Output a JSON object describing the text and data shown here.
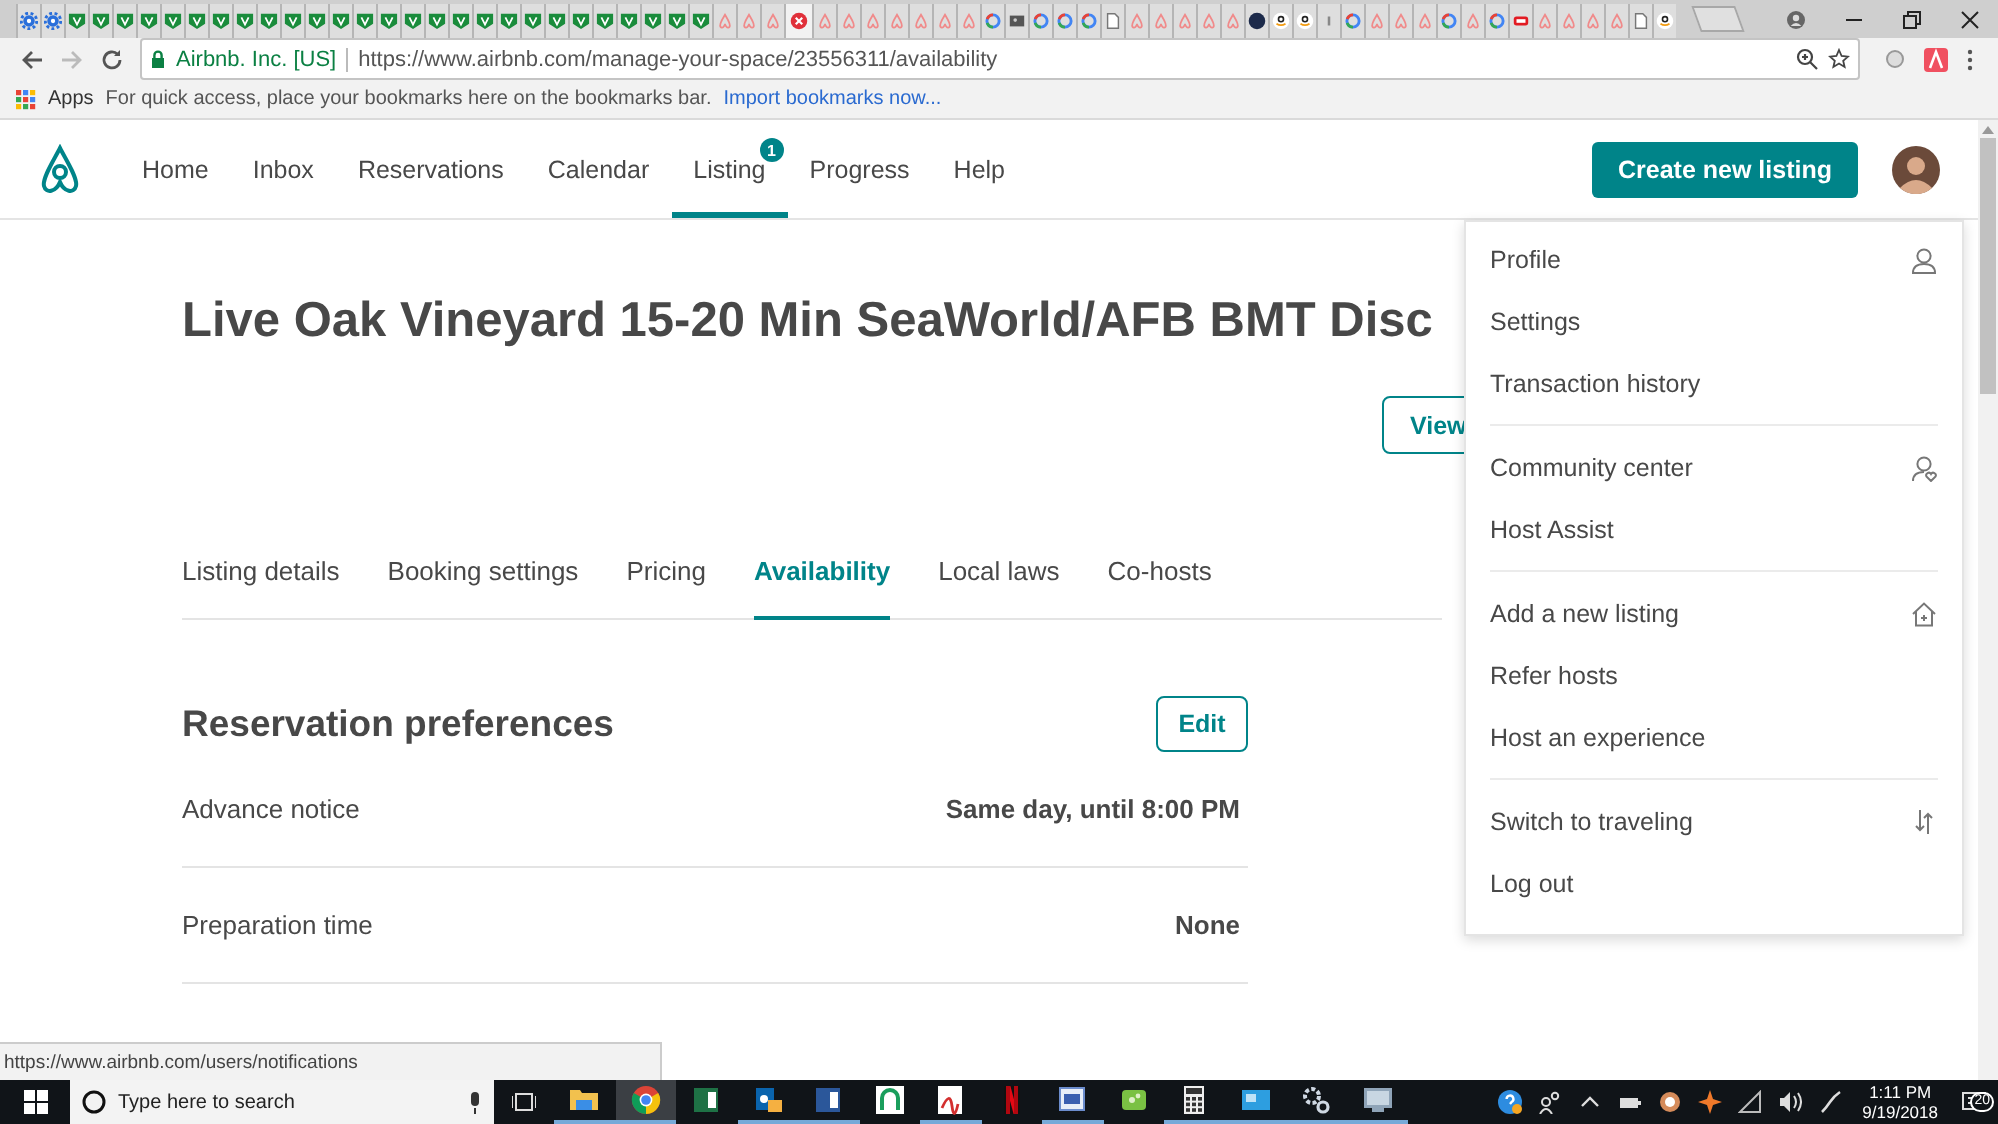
{
  "browser": {
    "tabs": [
      {
        "kind": "gear",
        "selected": false
      },
      {
        "kind": "gear",
        "selected": false
      },
      {
        "kind": "v",
        "selected": false
      },
      {
        "kind": "v",
        "selected": false
      },
      {
        "kind": "v",
        "selected": false
      },
      {
        "kind": "v",
        "selected": false
      },
      {
        "kind": "v",
        "selected": false
      },
      {
        "kind": "v",
        "selected": false
      },
      {
        "kind": "v",
        "selected": false
      },
      {
        "kind": "v",
        "selected": false
      },
      {
        "kind": "v",
        "selected": false
      },
      {
        "kind": "v",
        "selected": false
      },
      {
        "kind": "v",
        "selected": false
      },
      {
        "kind": "v",
        "selected": false
      },
      {
        "kind": "v",
        "selected": false
      },
      {
        "kind": "v",
        "selected": false
      },
      {
        "kind": "v",
        "selected": false
      },
      {
        "kind": "v",
        "selected": false
      },
      {
        "kind": "v",
        "selected": false
      },
      {
        "kind": "v",
        "selected": false
      },
      {
        "kind": "v",
        "selected": false
      },
      {
        "kind": "v",
        "selected": false
      },
      {
        "kind": "v",
        "selected": false
      },
      {
        "kind": "v",
        "selected": false
      },
      {
        "kind": "v",
        "selected": false
      },
      {
        "kind": "v",
        "selected": false
      },
      {
        "kind": "v",
        "selected": false
      },
      {
        "kind": "v",
        "selected": false
      },
      {
        "kind": "v",
        "selected": false
      },
      {
        "kind": "airbnb",
        "selected": false
      },
      {
        "kind": "airbnb",
        "selected": false
      },
      {
        "kind": "airbnb",
        "selected": false
      },
      {
        "kind": "error",
        "selected": true
      },
      {
        "kind": "airbnb",
        "selected": false
      },
      {
        "kind": "airbnb",
        "selected": false
      },
      {
        "kind": "airbnb",
        "selected": false
      },
      {
        "kind": "airbnb",
        "selected": false
      },
      {
        "kind": "airbnb",
        "selected": false
      },
      {
        "kind": "airbnb",
        "selected": false
      },
      {
        "kind": "airbnb",
        "selected": false
      },
      {
        "kind": "google",
        "selected": false
      },
      {
        "kind": "photo",
        "selected": false
      },
      {
        "kind": "google",
        "selected": false
      },
      {
        "kind": "google",
        "selected": false
      },
      {
        "kind": "google",
        "selected": false
      },
      {
        "kind": "doc",
        "selected": false
      },
      {
        "kind": "airbnb",
        "selected": false
      },
      {
        "kind": "airbnb",
        "selected": false
      },
      {
        "kind": "airbnb",
        "selected": false
      },
      {
        "kind": "airbnb",
        "selected": false
      },
      {
        "kind": "airbnb",
        "selected": false
      },
      {
        "kind": "dark",
        "selected": false
      },
      {
        "kind": "amazon",
        "selected": false
      },
      {
        "kind": "amazon",
        "selected": false
      },
      {
        "kind": "bar",
        "selected": false
      },
      {
        "kind": "google",
        "selected": false
      },
      {
        "kind": "airbnb",
        "selected": false
      },
      {
        "kind": "airbnb",
        "selected": false
      },
      {
        "kind": "airbnb",
        "selected": false
      },
      {
        "kind": "google",
        "selected": false
      },
      {
        "kind": "airbnb",
        "selected": false
      },
      {
        "kind": "google",
        "selected": false
      },
      {
        "kind": "red",
        "selected": false
      },
      {
        "kind": "airbnb",
        "selected": false
      },
      {
        "kind": "airbnb",
        "selected": false
      },
      {
        "kind": "airbnb",
        "selected": false
      },
      {
        "kind": "airbnb",
        "selected": false
      },
      {
        "kind": "doc",
        "selected": false
      },
      {
        "kind": "amazon",
        "selected": false
      }
    ],
    "site_identity": "Airbnb. Inc. [US]",
    "url": "https://www.airbnb.com/manage-your-space/23556311/availability",
    "bookmarks": {
      "apps": "Apps",
      "hint": "For quick access, place your bookmarks here on the bookmarks bar.",
      "import_link": "Import bookmarks now..."
    },
    "status_url": "https://www.airbnb.com/users/notifications"
  },
  "site": {
    "nav": [
      {
        "label": "Home",
        "selected": false
      },
      {
        "label": "Inbox",
        "selected": false
      },
      {
        "label": "Reservations",
        "selected": false
      },
      {
        "label": "Calendar",
        "selected": false
      },
      {
        "label": "Listing",
        "selected": true,
        "badge": "1"
      },
      {
        "label": "Progress",
        "selected": false
      },
      {
        "label": "Help",
        "selected": false
      }
    ],
    "create_button": "Create new listing",
    "title": "Live Oak Vineyard 15-20 Min SeaWorld/AFB BMT Disc",
    "view_button": "View",
    "subtabs": [
      {
        "label": "Listing details",
        "selected": false
      },
      {
        "label": "Booking settings",
        "selected": false
      },
      {
        "label": "Pricing",
        "selected": false
      },
      {
        "label": "Availability",
        "selected": true
      },
      {
        "label": "Local laws",
        "selected": false
      },
      {
        "label": "Co-hosts",
        "selected": false
      }
    ],
    "section": {
      "heading": "Reservation preferences",
      "edit_button": "Edit",
      "rows": [
        {
          "label": "Advance notice",
          "value": "Same day, until 8:00 PM"
        },
        {
          "label": "Preparation time",
          "value": "None"
        }
      ]
    },
    "menu": {
      "sections": [
        [
          {
            "label": "Profile",
            "kind": "person"
          },
          {
            "label": "Settings",
            "kind": "plain"
          },
          {
            "label": "Transaction history",
            "kind": "plain"
          }
        ],
        [
          {
            "label": "Community center",
            "kind": "person-heart"
          },
          {
            "label": "Host Assist",
            "kind": "plain"
          }
        ],
        [
          {
            "label": "Add a new listing",
            "kind": "house"
          },
          {
            "label": "Refer hosts",
            "kind": "plain"
          },
          {
            "label": "Host an experience",
            "kind": "plain"
          }
        ],
        [
          {
            "label": "Switch to traveling",
            "kind": "switch"
          },
          {
            "label": "Log out",
            "kind": "plain"
          }
        ]
      ]
    }
  },
  "taskbar": {
    "search": {
      "placeholder": "Type here to search"
    },
    "apps": [
      {
        "kind": "folder",
        "selected": false,
        "running": true
      },
      {
        "kind": "chrome",
        "selected": true,
        "running": true
      },
      {
        "kind": "excel",
        "selected": false,
        "running": false
      },
      {
        "kind": "outlook",
        "selected": false,
        "running": true
      },
      {
        "kind": "word",
        "selected": false,
        "running": true
      },
      {
        "kind": "arch",
        "selected": false,
        "running": false
      },
      {
        "kind": "pdf",
        "selected": false,
        "running": true
      },
      {
        "kind": "netflix",
        "selected": false,
        "running": false
      },
      {
        "kind": "pr",
        "selected": false,
        "running": true
      },
      {
        "kind": "puzzle",
        "selected": false,
        "running": false
      },
      {
        "kind": "calculator",
        "selected": false,
        "running": true
      },
      {
        "kind": "card",
        "selected": false,
        "running": true
      },
      {
        "kind": "gears",
        "selected": false,
        "running": true
      },
      {
        "kind": "monitor",
        "selected": false,
        "running": true
      }
    ],
    "time": "1:11 PM",
    "date": "9/19/2018",
    "notifications": "20"
  }
}
